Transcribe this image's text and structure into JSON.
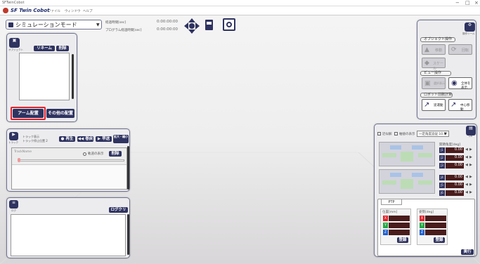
{
  "window": {
    "title": "SFTwinCobot",
    "minimize": "−",
    "maximize": "□",
    "close": "×"
  },
  "menu": {
    "app_name": "SF Twin Cobot",
    "items": [
      "ファイル",
      "ウィンドウ",
      "ヘルプ"
    ]
  },
  "mode": {
    "label": "シミュレーションモード"
  },
  "time": {
    "elapsed_label": "経過時間[sec]",
    "elapsed_value": "0:00:00:00",
    "program_label": "プログラム経過時間[sec]",
    "program_value": "0:00:00:00"
  },
  "arrange": {
    "tab_label": "オブジェクト",
    "reset_label": "リネーム",
    "delete_label": "削除",
    "arm_button": "アーム配置",
    "other_button": "その他の配置"
  },
  "track": {
    "tab_label": "トラック",
    "title_line1": "トラック表示",
    "title_line2": "トラック停止位置 2",
    "play": "再生",
    "rewind": "巻戻",
    "fast": "早送",
    "zoom": "拡大・縮小",
    "name": "TrackName",
    "show_label": "軌道の表示",
    "delete_label": "削除"
  },
  "log": {
    "tab_label": "ログ",
    "clear_label": "ログクリア"
  },
  "ops": {
    "tab_label": "操作ツール",
    "object_section": "オブジェクト操作",
    "move_label": "移動",
    "rotate_label": "回転",
    "scale_label": "スケール",
    "view_section": "ビュー操作",
    "select_label": "選択表示",
    "all_label": "全体を表示",
    "robot_section": "ロボット前腕計算",
    "ik_label": "逆運動",
    "center_label": "中心移動"
  },
  "joint": {
    "tab_label": "DH",
    "approx_label": "近似解",
    "auto_label": "軸値の表示",
    "select_value": "一定角度追従 10.0",
    "angle_title": "関節角度[deg]",
    "joints": [
      {
        "name": "J1",
        "value": "0.00"
      },
      {
        "name": "J2",
        "value": "0.00"
      },
      {
        "name": "J3",
        "value": "0.00"
      },
      {
        "name": "J4",
        "value": "0.00"
      },
      {
        "name": "J5",
        "value": "0.00"
      },
      {
        "name": "J6",
        "value": "0.00"
      }
    ],
    "ptp_tab": "PTP",
    "pos_label": "位置[mm]",
    "rot_label": "姿勢[deg]",
    "axes": [
      "X",
      "Y",
      "Z"
    ],
    "apply_label": "登録",
    "apply2_label": "登録",
    "exec_label": "実行"
  },
  "colors": {
    "accent": "#2f3360",
    "highlight": "#e0222a",
    "dark_field": "#4a1c1c"
  }
}
